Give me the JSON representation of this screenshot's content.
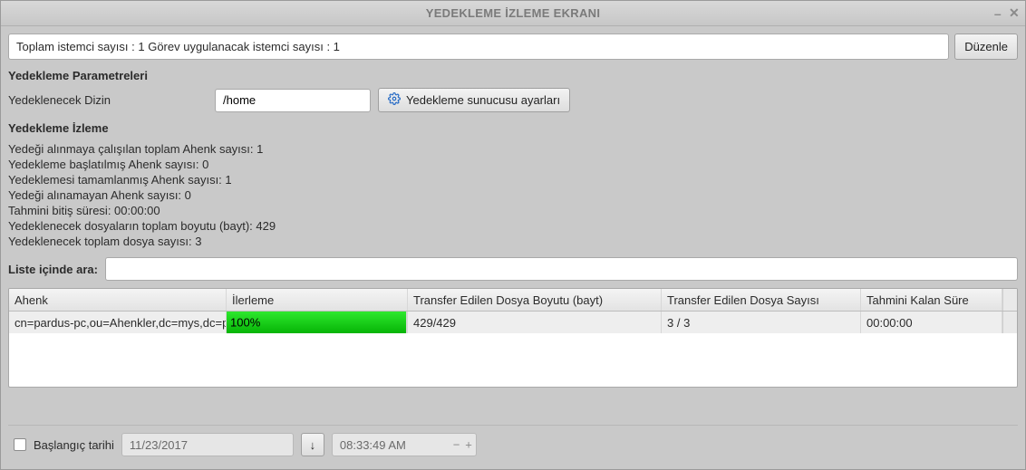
{
  "window": {
    "title": "YEDEKLEME İZLEME EKRANI"
  },
  "info_bar": {
    "text": "Toplam istemci sayısı : 1   Görev uygulanacak istemci sayısı : 1",
    "edit_label": "Düzenle"
  },
  "params": {
    "section_title": "Yedekleme Parametreleri",
    "dir_label": "Yedeklenecek Dizin",
    "dir_value": "/home",
    "server_settings_label": "Yedekleme sunucusu ayarları"
  },
  "monitor": {
    "section_title": "Yedekleme İzleme",
    "lines": [
      "Yedeği alınmaya çalışılan toplam Ahenk sayısı: 1",
      "Yedekleme başlatılmış Ahenk sayısı: 0",
      "Yedeklemesi tamamlanmış Ahenk sayısı: 1",
      "Yedeği alınamayan Ahenk sayısı: 0",
      "Tahmini bitiş süresi: 00:00:00",
      "Yedeklenecek dosyaların toplam boyutu (bayt): 429",
      "Yedeklenecek toplam dosya sayısı: 3"
    ]
  },
  "search": {
    "label": "Liste içinde ara:",
    "value": ""
  },
  "table": {
    "headers": {
      "ahenk": "Ahenk",
      "progress": "İlerleme",
      "bytes": "Transfer Edilen Dosya Boyutu (bayt)",
      "files": "Transfer Edilen Dosya Sayısı",
      "eta": "Tahmini Kalan Süre"
    },
    "rows": [
      {
        "ahenk": "cn=pardus-pc,ou=Ahenkler,dc=mys,dc=pardus",
        "progress_text": "100%",
        "progress_pct": 100,
        "bytes": "429/429",
        "files": "3 / 3",
        "eta": "00:00:00"
      }
    ]
  },
  "footer": {
    "start_label": "Başlangıç tarihi",
    "date_value": "11/23/2017",
    "time_value": "08:33:49 AM"
  }
}
